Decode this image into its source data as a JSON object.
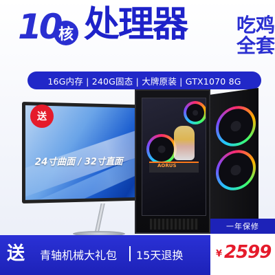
{
  "headline": {
    "number": "10",
    "core_char": "核",
    "main": "处理器",
    "side_line1": "吃鸡",
    "side_line2": "全套"
  },
  "spec_bar": {
    "text": "16G内存 | 240G固态 | 大牌原装 | GTX1070 8G"
  },
  "monitor": {
    "gift_badge": "送",
    "label": "24寸曲面 / 32寸直面"
  },
  "tower": {
    "gpu_brand": "AORUS"
  },
  "bottom_bar": {
    "send": "送",
    "gift": "青轴机械大礼包",
    "return_policy": "15天退换"
  },
  "price": {
    "warranty": "一年保修",
    "currency": "¥",
    "amount": "2599"
  },
  "colors": {
    "brand_blue": "#2128c8",
    "accent_red": "#e51b2b"
  }
}
